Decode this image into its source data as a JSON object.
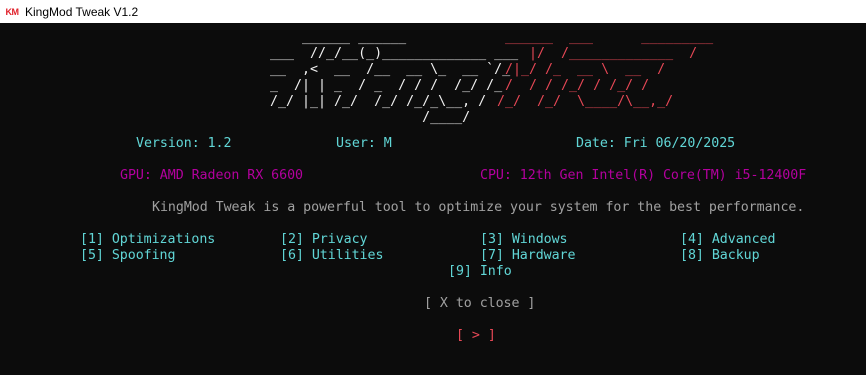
{
  "window": {
    "title": "KingMod Tweak V1.2",
    "icon_text_k": "K",
    "icon_text_m": "M"
  },
  "banner": {
    "white_lines": [
      "     ______ ______                  ",
      " ___  //_/__(_)_____________ ___    ",
      " __  ,<  __  /__  __ \\_  __ `/_  ",
      " _  /| | _  / _  / / /  /_/ /_  ",
      " /_/ |_| /_/  /_/ /_/_\\__, /  ",
      "                    /____/      "
    ],
    "red_lines": [
      "______  ___      _________",
      "   |/  /_____________  /",
      " /|_/ /_  __ \\  __  /",
      " /  / / /_/ / /_/ /",
      "/_/  /_/  \\____/\\__,_/",
      ""
    ]
  },
  "info": {
    "version": "Version: 1.2",
    "user": "User: M",
    "date": "Date: Fri 06/20/2025",
    "gpu": "GPU: AMD Radeon RX 6600",
    "cpu": "CPU: 12th Gen Intel(R) Core(TM) i5-12400F"
  },
  "description": "KingMod Tweak is a powerful tool to optimize your system for the best performance.",
  "menu": {
    "items": [
      "[1] Optimizations",
      "[2] Privacy",
      "[3] Windows",
      "[4] Advanced",
      "[5] Spoofing",
      "[6] Utilities",
      "[7] Hardware",
      "[8] Backup",
      "[9] Info"
    ]
  },
  "close_hint": "[ X to close ]",
  "prompt": "[ > ]",
  "colors": {
    "background": "#0c0c0c",
    "white": "#f2f2f2",
    "red": "#e74856",
    "cyan": "#61d6d6",
    "magenta": "#b4009e",
    "gray": "#a0a0a0"
  }
}
